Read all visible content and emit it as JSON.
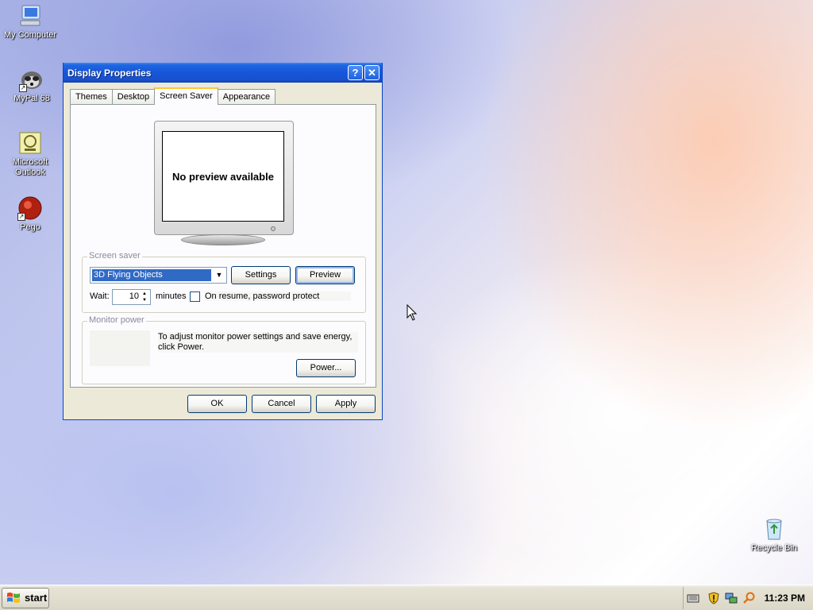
{
  "desktop": {
    "icons": [
      {
        "label": "My Computer",
        "icon": "my-computer-icon"
      },
      {
        "label": "MyPal 68",
        "icon": "mypal-icon"
      },
      {
        "label": "Microsoft Outlook",
        "icon": "outlook-icon"
      },
      {
        "label": "Pego",
        "icon": "pego-icon"
      },
      {
        "label": "Recycle Bin",
        "icon": "recycle-bin-icon"
      }
    ]
  },
  "window": {
    "title": "Display Properties",
    "help_label": "?",
    "close_label": "✕",
    "tabs": [
      {
        "label": "Themes"
      },
      {
        "label": "Desktop"
      },
      {
        "label": "Screen Saver",
        "active": true
      },
      {
        "label": "Appearance"
      }
    ],
    "preview_text": "No preview available",
    "screen_saver": {
      "group_title": "Screen saver",
      "selected": "3D Flying Objects",
      "settings_label": "Settings",
      "preview_label": "Preview",
      "wait_label": "Wait:",
      "wait_value": "10",
      "minutes_label": "minutes",
      "password_label": "On resume, password protect",
      "password_checked": false
    },
    "monitor_power": {
      "group_title": "Monitor power",
      "description": "To adjust monitor power settings and save energy, click Power.",
      "power_label": "Power..."
    },
    "footer": {
      "ok_label": "OK",
      "cancel_label": "Cancel",
      "apply_label": "Apply"
    }
  },
  "taskbar": {
    "start_label": "start",
    "clock": "11:23 PM"
  },
  "colors": {
    "titlebar": "#1656d8",
    "selection": "#316ac5",
    "tab_highlight": "#ffc83c"
  }
}
